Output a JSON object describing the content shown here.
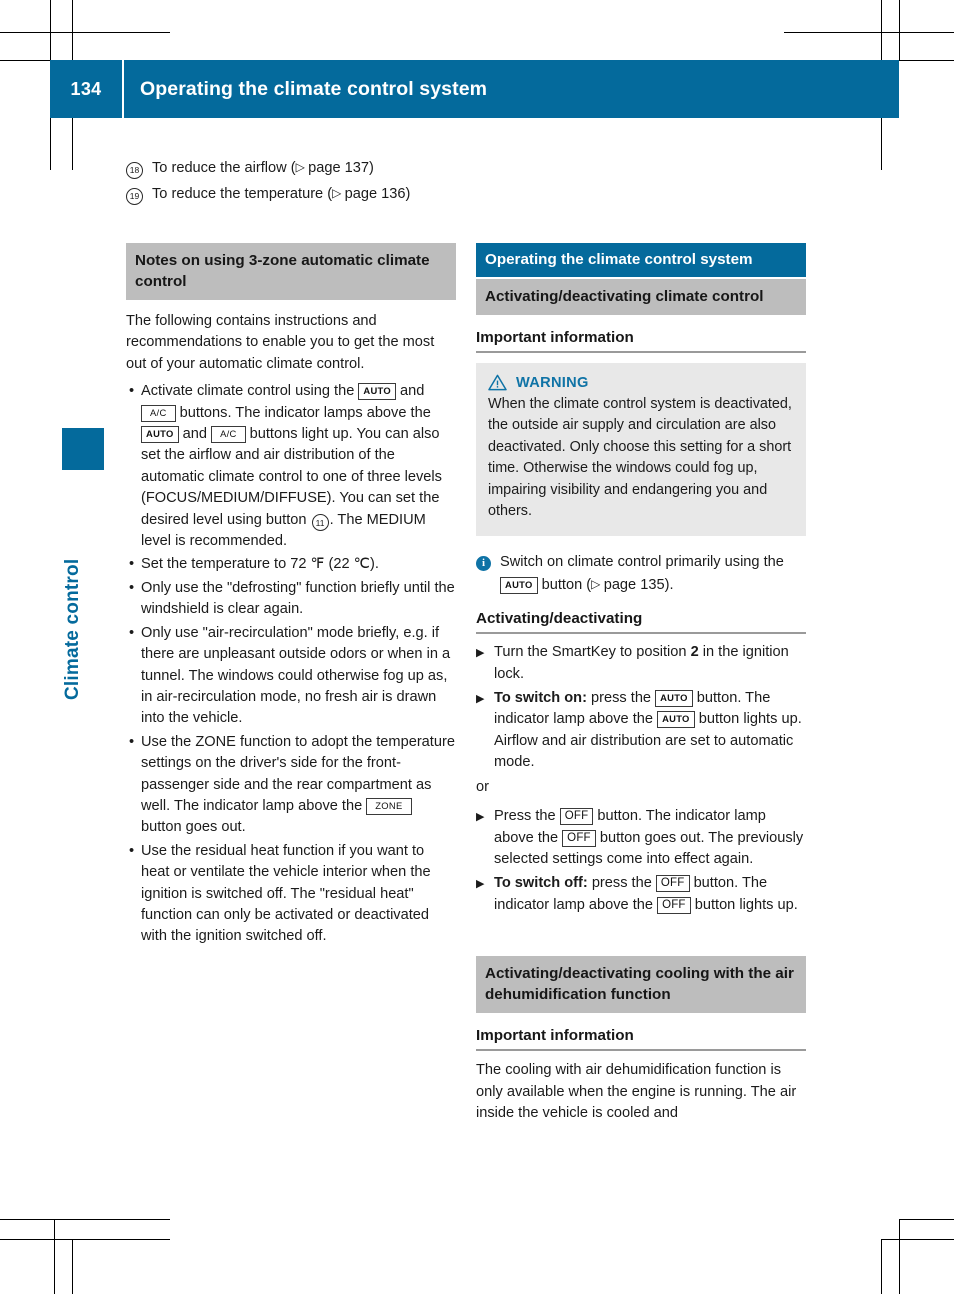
{
  "colors": {
    "brand_blue": "#046a9c",
    "heading_gray": "#bdbdbd",
    "warning_blue": "#0f73a6",
    "warning_box_bg": "#e8e8e8"
  },
  "header": {
    "page_number": "134",
    "title": "Operating the climate control system"
  },
  "side_tab": {
    "label": "Climate control"
  },
  "legend": [
    {
      "number": "18",
      "text_before": "To reduce the airflow (",
      "ref": "page 137",
      "text_after": ")"
    },
    {
      "number": "19",
      "text_before": "To reduce the temperature (",
      "ref": "page 136",
      "text_after": ")"
    }
  ],
  "left_column": {
    "heading": "Notes on using 3-zone automatic climate control",
    "intro": "The following contains instructions and recommendations to enable you to get the most out of your automatic climate control.",
    "bullets": [
      {
        "parts": [
          {
            "t": "text",
            "v": "Activate climate control using the "
          },
          {
            "t": "button",
            "v": "AUTO"
          },
          {
            "t": "text",
            "v": " and "
          },
          {
            "t": "button",
            "v": "A/C"
          },
          {
            "t": "text",
            "v": " buttons. The indicator lamps above the "
          },
          {
            "t": "button",
            "v": "AUTO"
          },
          {
            "t": "text",
            "v": " and "
          },
          {
            "t": "button",
            "v": "A/C"
          },
          {
            "t": "text",
            "v": " buttons light up. You can also set the airflow and air distribution of the automatic climate control to one of three levels (FOCUS/MEDIUM/DIFFUSE). You can set the desired level using button "
          },
          {
            "t": "circled",
            "v": "11"
          },
          {
            "t": "text",
            "v": ". The MEDIUM level is recommended."
          }
        ]
      },
      {
        "parts": [
          {
            "t": "text",
            "v": "Set the temperature to 72 ℉ (22 ℃)."
          }
        ]
      },
      {
        "parts": [
          {
            "t": "text",
            "v": "Only use the \"defrosting\" function briefly until the windshield is clear again."
          }
        ]
      },
      {
        "parts": [
          {
            "t": "text",
            "v": "Only use \"air-recirculation\" mode briefly, e.g. if there are unpleasant outside odors or when in a tunnel. The windows could otherwise fog up as, in air-recirculation mode, no fresh air is drawn into the vehicle."
          }
        ]
      },
      {
        "parts": [
          {
            "t": "text",
            "v": "Use the ZONE function to adopt the temperature settings on the driver's side for the front-passenger side and the rear compartment as well. The indicator lamp above the "
          },
          {
            "t": "button",
            "v": "ZONE"
          },
          {
            "t": "text",
            "v": " button goes out."
          }
        ]
      },
      {
        "parts": [
          {
            "t": "text",
            "v": "Use the residual heat function if you want to heat or ventilate the vehicle interior when the ignition is switched off. The \"residual heat\" function can only be activated or deactivated with the ignition switched off."
          }
        ]
      }
    ]
  },
  "right_column": {
    "section_title": "Operating the climate control system",
    "subsection_title": "Activating/deactivating climate control",
    "important_information_label": "Important information",
    "warning": {
      "icon": "warning-triangle-icon",
      "label": "WARNING",
      "body": "When the climate control system is deactivated, the outside air supply and circulation are also deactivated. Only choose this setting for a short time. Otherwise the windows could fog up, impairing visibility and endangering you and others."
    },
    "note": {
      "icon": "info-icon",
      "parts": [
        {
          "t": "text",
          "v": "Switch on climate control primarily using the "
        },
        {
          "t": "button",
          "v": "AUTO"
        },
        {
          "t": "text",
          "v": " button ("
        },
        {
          "t": "ref",
          "v": "page 135"
        },
        {
          "t": "text",
          "v": ")."
        }
      ]
    },
    "activating_heading": "Activating/deactivating",
    "steps": [
      {
        "parts": [
          {
            "t": "text",
            "v": "Turn the SmartKey to position "
          },
          {
            "t": "bold",
            "v": "2"
          },
          {
            "t": "text",
            "v": " in the ignition lock."
          }
        ]
      },
      {
        "parts": [
          {
            "t": "bold",
            "v": "To switch on:"
          },
          {
            "t": "text",
            "v": " press the "
          },
          {
            "t": "button",
            "v": "AUTO"
          },
          {
            "t": "text",
            "v": " button. The indicator lamp above the "
          },
          {
            "t": "button",
            "v": "AUTO"
          },
          {
            "t": "text",
            "v": " button lights up. Airflow and air distribution are set to automatic mode."
          }
        ]
      }
    ],
    "or_label": "or",
    "steps2": [
      {
        "parts": [
          {
            "t": "text",
            "v": "Press the "
          },
          {
            "t": "button-off",
            "v": "OFF"
          },
          {
            "t": "text",
            "v": " button. The indicator lamp above the "
          },
          {
            "t": "button-off",
            "v": "OFF"
          },
          {
            "t": "text",
            "v": " button goes out. The previously selected settings come into effect again."
          }
        ]
      },
      {
        "parts": [
          {
            "t": "bold",
            "v": "To switch off:"
          },
          {
            "t": "text",
            "v": " press the "
          },
          {
            "t": "button-off",
            "v": "OFF"
          },
          {
            "t": "text",
            "v": " button. The indicator lamp above the "
          },
          {
            "t": "button-off",
            "v": "OFF"
          },
          {
            "t": "text",
            "v": " button lights up."
          }
        ]
      }
    ],
    "cooling_heading": "Activating/deactivating cooling with the air dehumidification function",
    "cooling_important_label": "Important information",
    "cooling_body": "The cooling with air dehumidification function is only available when the engine is running. The air inside the vehicle is cooled and"
  }
}
